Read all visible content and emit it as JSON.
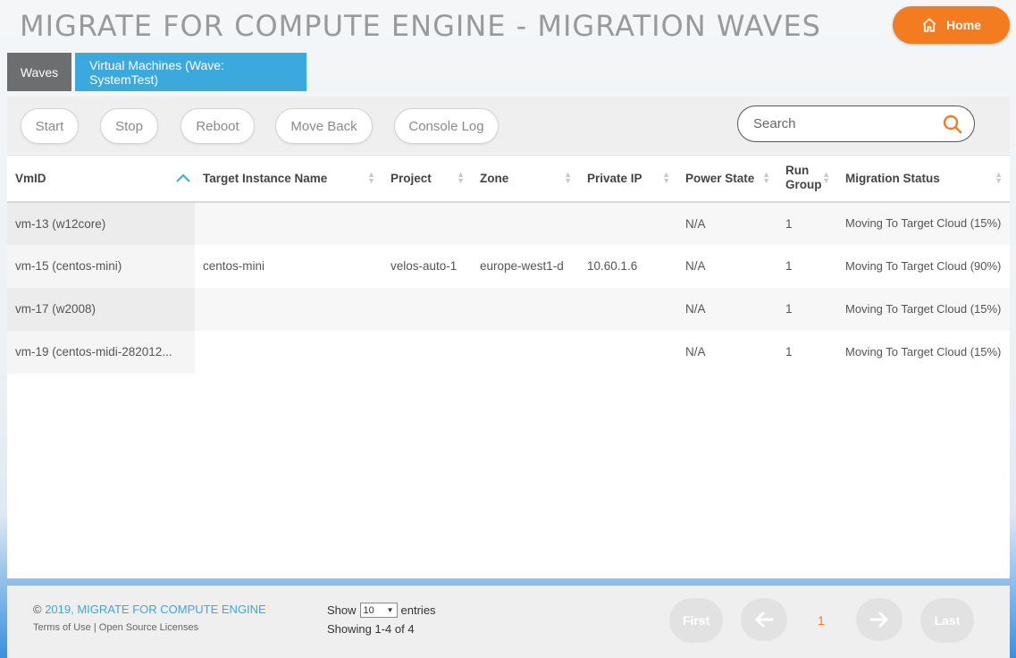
{
  "app": {
    "title": "MIGRATE FOR COMPUTE ENGINE - MIGRATION WAVES",
    "home_label": "Home"
  },
  "tabs": [
    {
      "label": "Waves"
    },
    {
      "label": "Virtual Machines (Wave: SystemTest)"
    }
  ],
  "toolbar": {
    "start": "Start",
    "stop": "Stop",
    "reboot": "Reboot",
    "move_back": "Move Back",
    "console_log": "Console Log",
    "search_placeholder": "Search"
  },
  "table": {
    "columns": [
      "VmID",
      "Target Instance Name",
      "Project",
      "Zone",
      "Private IP",
      "Power State",
      "Run Group",
      "Migration Status"
    ],
    "rows": [
      {
        "vmid": "vm-13 (w12core)",
        "target": "",
        "project": "",
        "zone": "",
        "ip": "",
        "power": "N/A",
        "group": "1",
        "status": "Moving To Target Cloud (15%)"
      },
      {
        "vmid": "vm-15 (centos-mini)",
        "target": "centos-mini",
        "project": "velos-auto-1",
        "zone": "europe-west1-d",
        "ip": "10.60.1.6",
        "power": "N/A",
        "group": "1",
        "status": "Moving To Target Cloud (90%)"
      },
      {
        "vmid": "vm-17 (w2008)",
        "target": "",
        "project": "",
        "zone": "",
        "ip": "",
        "power": "N/A",
        "group": "1",
        "status": "Moving To Target Cloud (15%)"
      },
      {
        "vmid": "vm-19 (centos-midi-282012...",
        "target": "",
        "project": "",
        "zone": "",
        "ip": "",
        "power": "N/A",
        "group": "1",
        "status": "Moving To Target Cloud (15%)"
      }
    ]
  },
  "footer": {
    "copyright_prefix": "© ",
    "copyright_brand": "2019, MIGRATE FOR COMPUTE ENGINE",
    "terms": "Terms of Use",
    "separator": " | ",
    "licenses": "Open Source Licenses",
    "show_label": "Show",
    "page_size": "10",
    "entries_label": "entries",
    "showing": "Showing 1-4 of 4",
    "first": "First",
    "last": "Last",
    "page": "1"
  },
  "colors": {
    "accent_orange": "#f47c20",
    "accent_blue": "#3ba9de",
    "tab_gray": "#6d6e70"
  }
}
